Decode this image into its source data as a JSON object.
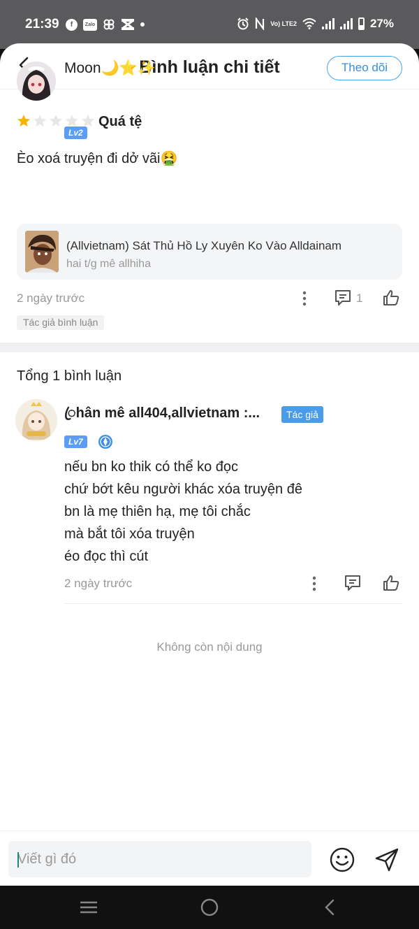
{
  "status_bar": {
    "time": "21:39",
    "zalo_label": "Zalo",
    "network_label": "Vo) LTE2",
    "battery": "27%"
  },
  "header": {
    "title": "Bình luận chi tiết"
  },
  "main_comment": {
    "username": "Moon🌙⭐✨",
    "level": "Lv2",
    "follow_label": "Theo dõi",
    "rating_stars": 1,
    "rating_max": 5,
    "rating_text": "Quá tệ",
    "text": "Èo xoá truyện đi dở vãi🤮",
    "story": {
      "title": "(Allvietnam) Sát Thủ Hồ Ly Xuyên Ko Vào Alldainam",
      "author": "hai t/g mê allhiha"
    },
    "time": "2 ngày trước",
    "reply_count": "1",
    "author_tag": "Tác giả bình luận"
  },
  "replies_section": {
    "total_label": "Tổng 1 bình luận",
    "reply": {
      "username": "ꦿhân mê all404,allvietnam :...",
      "author_badge": "Tác giả",
      "level": "Lv7",
      "lines": [
        "nếu bn ko thik có thể ko đọc",
        "chứ bớt kêu người khác xóa truyện đê",
        "bn là mẹ thiên hạ, mẹ tôi chắc",
        "mà bắt tôi xóa truyện",
        "éo đọc thì cút"
      ],
      "time": "2 ngày trước"
    },
    "end_label": "Không còn nội dung"
  },
  "input_bar": {
    "placeholder": "Viết gì đó"
  },
  "colors": {
    "accent": "#4a9ce8",
    "level_badge": "#5b9cf5",
    "star_active": "#f5b400",
    "star_inactive": "#e6e6e6"
  }
}
